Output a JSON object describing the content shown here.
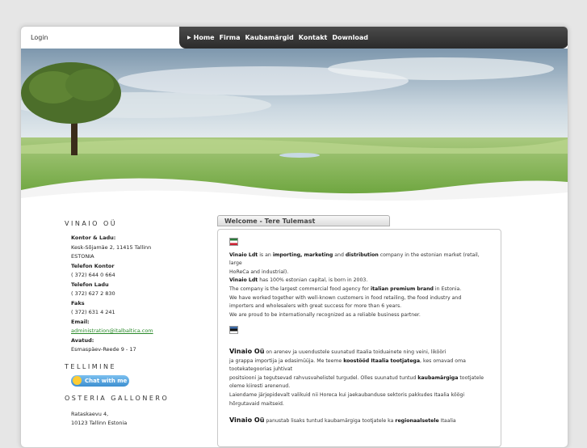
{
  "header": {
    "login_label": "Login",
    "nav": [
      "Home",
      "Firma",
      "Kaubamärgid",
      "Kontakt",
      "Download"
    ]
  },
  "sidebar": {
    "vinaio_title": "VINAIO OÜ",
    "office_label": "Kontor & Ladu:",
    "office_address": "Kesk-Sõjamäe 2, 11415 Tallinn",
    "office_country": "ESTONIA",
    "phone_office_label": "Telefon Kontor",
    "phone_office": "( 372) 644 0 664",
    "phone_warehouse_label": "Telefon Ladu",
    "phone_warehouse": "( 372) 627 2 830",
    "fax_label": "Faks",
    "fax": "( 372) 631 4 241",
    "email_label": "Email:",
    "email": "administration@italbaltica.com",
    "hours_label": "Avatud:",
    "hours": "Esmaspäev-Reede 9 - 17",
    "order_title": "TELLIMINE",
    "chat_label": "Chat with me",
    "osteria_title": "OSTERIA GALLONERO",
    "osteria_street": "Rataskaevu 4,",
    "osteria_city": "10123 Tallinn Estonia"
  },
  "main": {
    "welcome_tab": "Welcome - Tere Tulemast",
    "en_p1_a": "Vinaio Ldt",
    "en_p1_b": " is an ",
    "en_p1_c": "importing, marketing",
    "en_p1_d": " and ",
    "en_p1_e": "distribution",
    "en_p1_f": " company in the estonian market (retail, large",
    "en_p1_g": "HoReCa and industrial).",
    "en_p2_a": "Vinaio Ldt",
    "en_p2_b": " has 100% estonian capital, is born in 2003.",
    "en_p3_a": "The company is the largest commercial food agency for ",
    "en_p3_b": "italian premium brand",
    "en_p3_c": " in Estonia.",
    "en_p4": "We have worked together with well-known customers in food retailing, the food industry  and",
    "en_p5": "importers and wholesalers with great success for more than 6 years.",
    "en_p6": "We are proud to be internationally recognized as a reliable business partner.",
    "et_p1_a": "Vinaio Oü",
    "et_p1_b": " on arenev ja uuendustele suunatud  Itaalia toiduainete ning veini, likööri",
    "et_p2_a": "ja grappa importija ja edasimüüja.  Me teeme ",
    "et_p2_b": "koostööd Itaalia tootjatega",
    "et_p2_c": ", kes omavad oma",
    "et_p3": "tootekategoorias juhtivat",
    "et_p4_a": "positsiooni ja tegutsevad rahvusvahelistel turgudel. Olles suunatud tuntud ",
    "et_p4_b": "kaubamärgiga",
    "et_p4_c": " tootjatele",
    "et_p5": "oleme kiiresti arenenud.",
    "et_p6": "Laiendame järjepidevalt valikuid nii Horeca kui jaekaubanduse sektoris pakkudes Itaalia köögi",
    "et_p7": "hõrgutavaid maitseid.",
    "et_p8_a": "Vinaio Oü",
    "et_p8_b": " panustab lisaks tuntud kaubamärgiga tootjatele ka ",
    "et_p8_c": "regionaalsetele",
    "et_p8_d": " Itaalia"
  }
}
